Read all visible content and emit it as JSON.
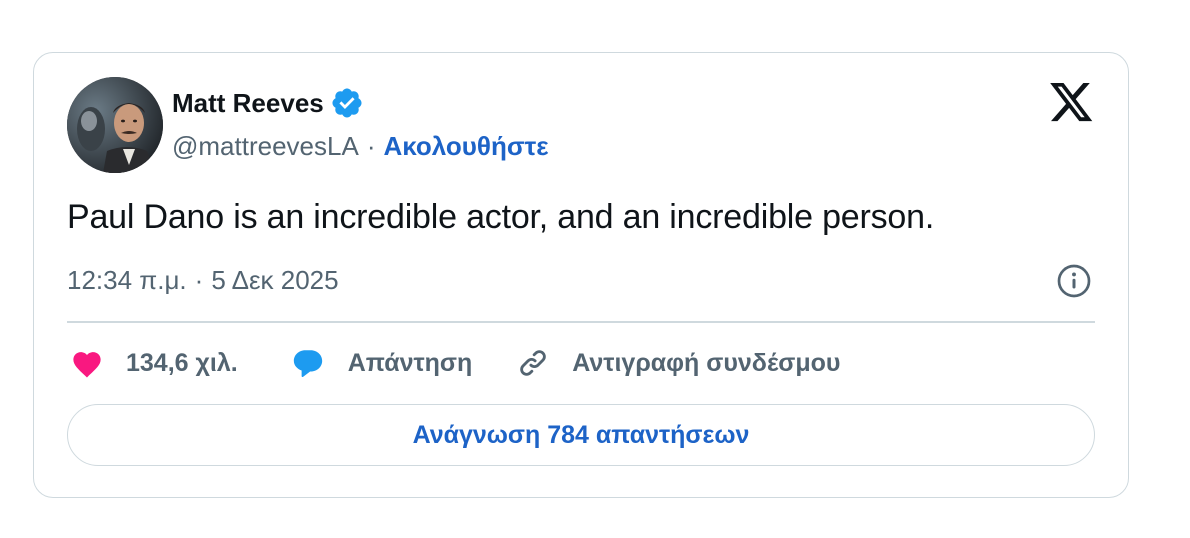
{
  "author": {
    "name": "Matt Reeves",
    "handle": "@mattreevesLA",
    "separator": "·",
    "follow_label": "Ακολουθήστε",
    "verified": true
  },
  "tweet": {
    "text": "Paul Dano is an incredible actor, and an incredible person.",
    "time": "12:34 π.μ.",
    "separator": "·",
    "date": "5 Δεκ 2025"
  },
  "actions": {
    "likes": "134,6 χιλ.",
    "reply_label": "Απάντηση",
    "copy_link_label": "Αντιγραφή συνδέσμου"
  },
  "read_replies_label": "Ανάγνωση 784 απαντήσεων",
  "icons": {
    "brand": "x-logo-icon",
    "verified": "verified-badge-icon",
    "info": "info-icon",
    "like": "heart-icon",
    "reply": "speech-bubble-icon",
    "copy": "link-icon"
  },
  "colors": {
    "accent": "#1d63c7",
    "verified": "#1d9bf0",
    "heart": "#f91880",
    "secondary_text": "#536471",
    "border": "#cfd9de"
  }
}
